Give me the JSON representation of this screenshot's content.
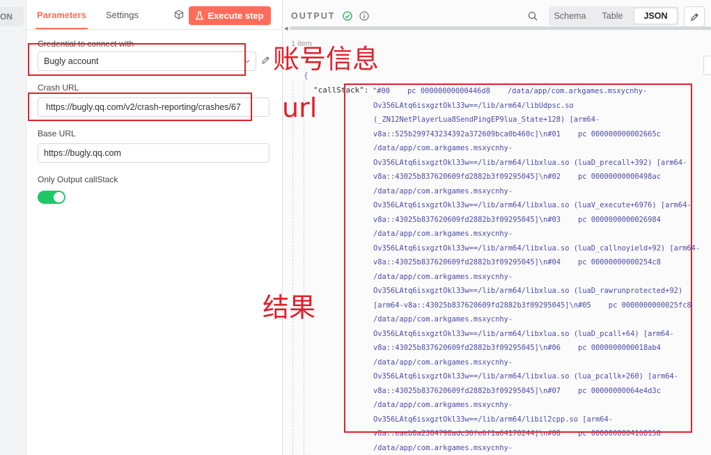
{
  "rail": {
    "label": "ON"
  },
  "params": {
    "tabs": [
      {
        "label": "Parameters"
      },
      {
        "label": "Settings"
      }
    ],
    "execute_label": "Execute step",
    "credential": {
      "label": "Credential to connect with",
      "value": "Bugly account"
    },
    "crash_url": {
      "label": "Crash URL",
      "value": "https://bugly.qq.com/v2/crash-reporting/crashes/67"
    },
    "base_url": {
      "label": "Base URL",
      "value": "https://bugly.qq.com"
    },
    "only_callstack": {
      "label": "Only Output callStack",
      "enabled": true
    }
  },
  "output": {
    "title": "OUTPUT",
    "views": [
      {
        "label": "Schema"
      },
      {
        "label": "Table"
      },
      {
        "label": "JSON",
        "active": true
      }
    ],
    "item_count": "1 item",
    "brace": "{",
    "key": "\"callStack\":",
    "value_lines": [
      "\"#00    pc 00000000000446d8    /data/app/com.arkgames.msxycnhy-",
      "Ov356LAtq6isxgztOkl33w==/lib/arm64/libUdpsc.so",
      "(_ZN12NetPlayerLua8SendPingEP9lua_State+128) [arm64-",
      "v8a::525b299743234392a372609bca0b460c]\\n#01    pc 000000000002665c",
      "/data/app/com.arkgames.msxycnhy-",
      "Ov356LAtq6isxgztOkl33w==/lib/arm64/libxlua.so (luaD_precall+392) [arm64-",
      "v8a::43025b837620609fd2882b3f09295045]\\n#02    pc 00000000000498ac",
      "/data/app/com.arkgames.msxycnhy-",
      "Ov356LAtq6isxgztOkl33w==/lib/arm64/libxlua.so (luaV_execute+6976) [arm64-",
      "v8a::43025b837620609fd2882b3f09295045]\\n#03    pc 0000000000026984",
      "/data/app/com.arkgames.msxycnhy-",
      "Ov356LAtq6isxgztOkl33w==/lib/arm64/libxlua.so (luaD_callnoyield+92) [arm64-",
      "v8a::43025b837620609fd2882b3f09295045]\\n#04    pc 00000000000254c8",
      "/data/app/com.arkgames.msxycnhy-",
      "Ov356LAtq6isxgztOkl33w==/lib/arm64/libxlua.so (luaD_rawrunprotected+92)",
      "[arm64-v8a::43025b837620609fd2882b3f09295045]\\n#05    pc 0000000000025fc8",
      "/data/app/com.arkgames.msxycnhy-",
      "Ov356LAtq6isxgztOkl33w==/lib/arm64/libxlua.so (luaD_pcall+64) [arm64-",
      "v8a::43025b837620609fd2882b3f09295045]\\n#06    pc 0000000000018ab4",
      "/data/app/com.arkgames.msxycnhy-",
      "Ov356LAtq6isxgztOkl33w==/lib/arm64/libxlua.so (lua_pcallk+260) [arm64-",
      "v8a::43025b837620609fd2882b3f09295045]\\n#07    pc 00000000064e4d3c",
      "/data/app/com.arkgames.msxycnhy-",
      "Ov356LAtq6isxgztOkl33w==/lib/arm64/libil2cpp.so [arm64-",
      "v8a::eaeb8a2384798adc36fe6f1a64170244]\\n#08    pc 0000000004168158",
      "/data/app/com.arkgames.msxycnhy-"
    ]
  },
  "annotations": {
    "account_note": "账号信息",
    "url_note": "url",
    "result_note": "结果",
    "color": "#e0202a"
  }
}
